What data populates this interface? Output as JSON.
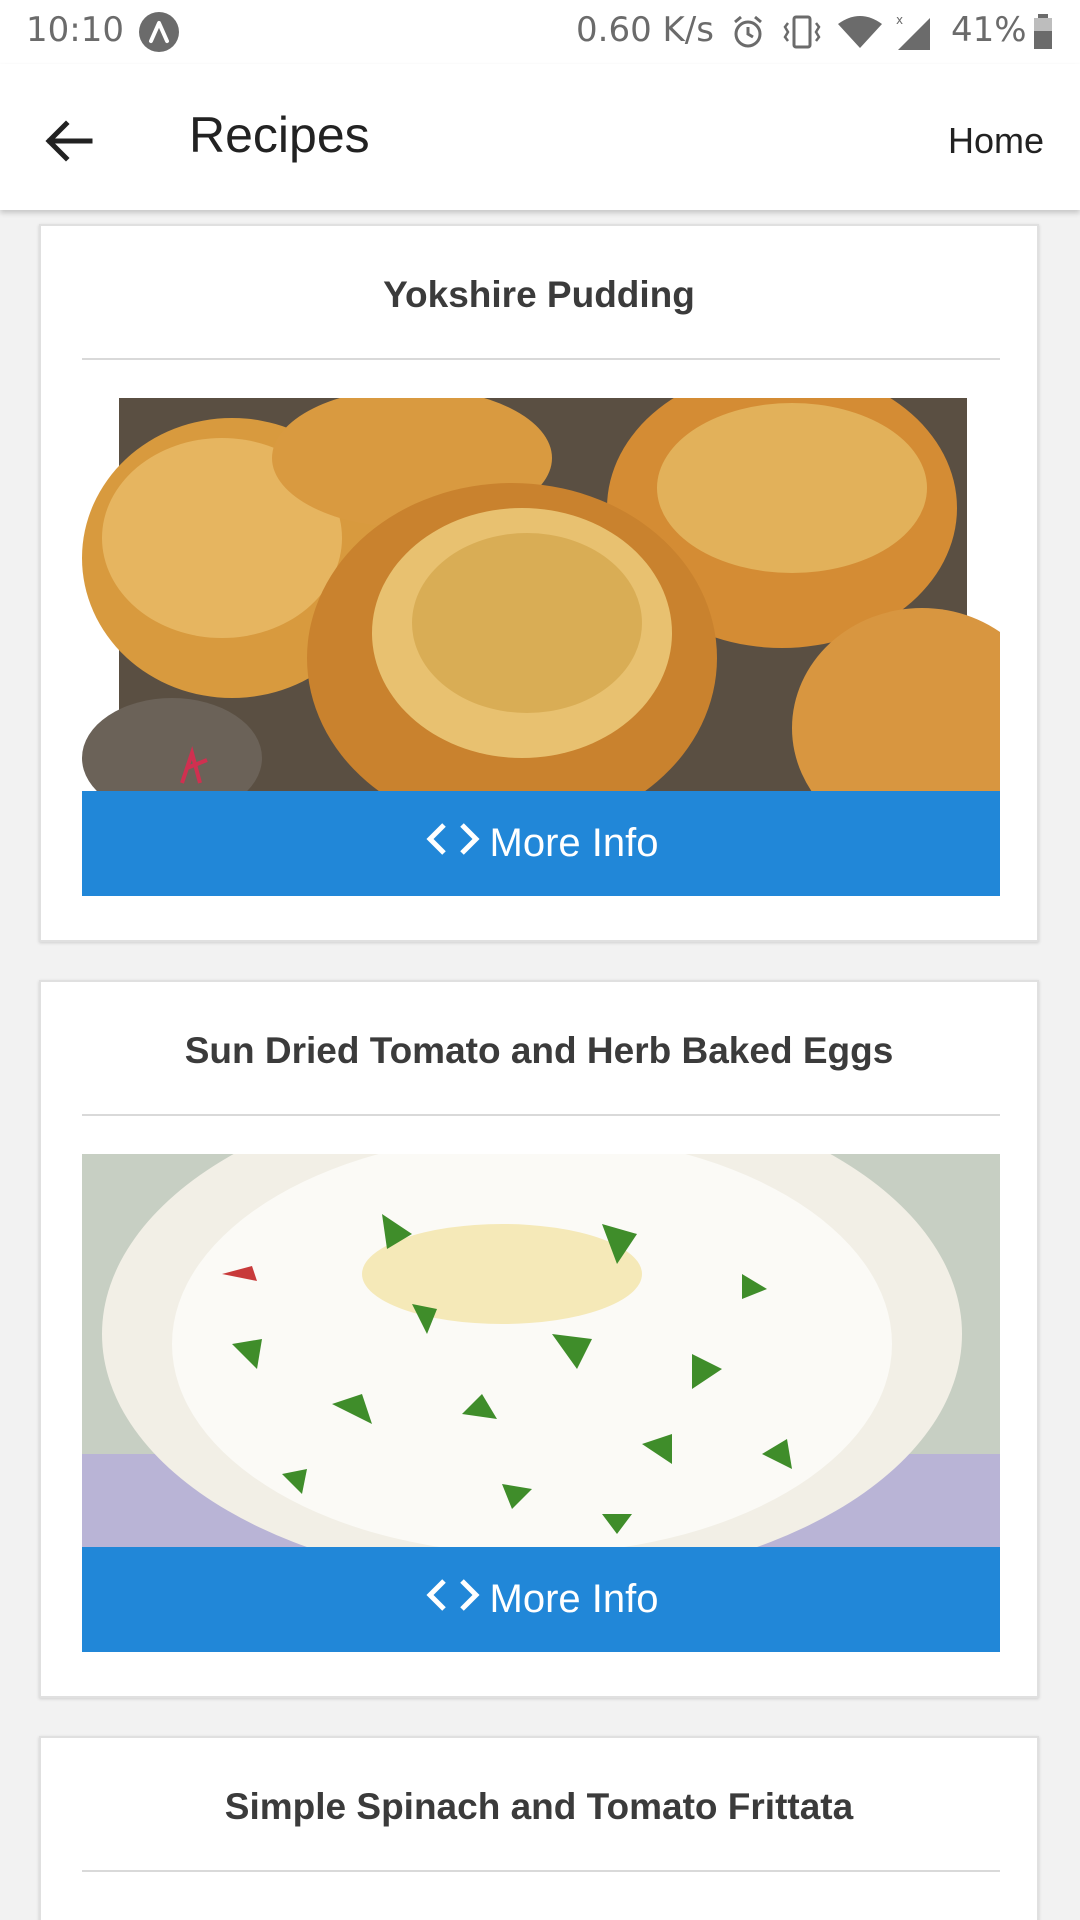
{
  "status_bar": {
    "time": "10:10",
    "speed": "0.60 K/s",
    "battery": "41%",
    "icons": [
      "app-notification-icon",
      "alarm-icon",
      "vibrate-icon",
      "wifi-icon",
      "signal-icon",
      "battery-icon"
    ]
  },
  "app_bar": {
    "back_icon": "arrow-back-icon",
    "title": "Recipes",
    "home_label": "Home"
  },
  "recipes": [
    {
      "title": "Yokshire Pudding",
      "button_label": "More Info",
      "button_icon": "code-icon"
    },
    {
      "title": "Sun Dried Tomato and Herb Baked Eggs",
      "button_label": "More Info",
      "button_icon": "code-icon"
    },
    {
      "title": "Simple Spinach and Tomato Frittata"
    }
  ],
  "colors": {
    "accent": "#2187d8",
    "background": "#f2f2f2",
    "card": "#ffffff",
    "text": "#3b3b3b"
  }
}
